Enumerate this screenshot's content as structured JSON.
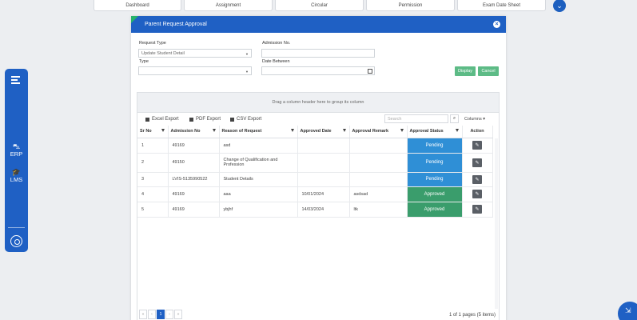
{
  "topnav": {
    "tabs": [
      {
        "label": "Dashboard"
      },
      {
        "label": "Assignment"
      },
      {
        "label": "Circular"
      },
      {
        "label": "Permission"
      },
      {
        "label": "Exam Date Sheet"
      }
    ]
  },
  "sidebar": {
    "erp_label": "ERP",
    "lms_label": "LMS"
  },
  "modal": {
    "title": "Parent Request Approval",
    "request_type_label": "Request Type",
    "request_type_value": "Update Student Detail",
    "type_label": "Type",
    "type_value": "",
    "admission_label": "Admission No.",
    "admission_value": "",
    "date_between_label": "Date Between",
    "date_between_value": "",
    "display_btn": "Display",
    "cancel_btn": "Cancel"
  },
  "grid": {
    "group_hint": "Drag a column header here to group its column",
    "excel_export": "Excel Export",
    "pdf_export": "PDF Export",
    "csv_export": "CSV Export",
    "search_placeholder": "Search",
    "columns_label": "Columns",
    "headers": {
      "srno": "Sr No",
      "admission": "Admission No",
      "reason": "Reason of Request",
      "approved_date": "Approved Date",
      "remark": "Approval Remark",
      "status": "Approval Status",
      "action": "Action"
    },
    "rows": [
      {
        "srno": "1",
        "admission": "49169",
        "reason": "asd",
        "approved_date": "",
        "remark": "",
        "status": "Pending"
      },
      {
        "srno": "2",
        "admission": "49150",
        "reason": "Change of Qualification and Profession",
        "approved_date": "",
        "remark": "",
        "status": "Pending"
      },
      {
        "srno": "3",
        "admission": "LVIS-5135990522",
        "reason": "Student Details",
        "approved_date": "",
        "remark": "",
        "status": "Pending"
      },
      {
        "srno": "4",
        "admission": "49169",
        "reason": "aaa",
        "approved_date": "10/01/2024",
        "remark": "asdsad",
        "status": "Approved"
      },
      {
        "srno": "5",
        "admission": "49169",
        "reason": "ybjhf",
        "approved_date": "14/03/2024",
        "remark": "ltk",
        "status": "Approved"
      }
    ],
    "pager": {
      "first": "«",
      "prev": "‹",
      "current": "1",
      "next": "›",
      "last": "»",
      "info": "1 of 1 pages (5 items)"
    }
  },
  "colors": {
    "primary": "#1f60c4",
    "pending": "#2f8fd6",
    "approved": "#3a9d6c",
    "button_green": "#5dbb86"
  }
}
